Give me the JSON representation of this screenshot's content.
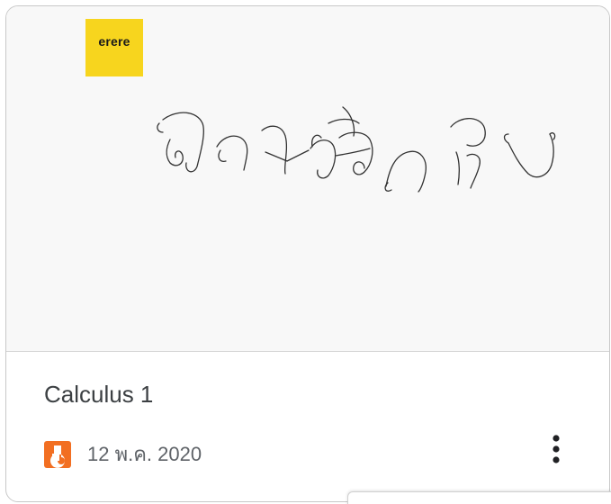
{
  "card": {
    "sticky_note_text": "erere",
    "title": "Calculus 1",
    "date": "12 พ.ค. 2020",
    "app_icon": "jamboard-icon",
    "menu_icon": "more-vert-icon"
  },
  "colors": {
    "sticky_note": "#f7d51e",
    "app_icon": "#f26f22",
    "title": "#3c4043",
    "date": "#5f6368"
  }
}
